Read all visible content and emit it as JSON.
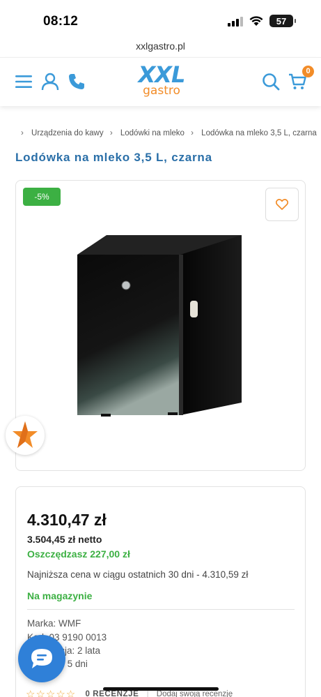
{
  "status": {
    "time": "08:12",
    "battery": "57"
  },
  "browser": {
    "url": "xxlgastro.pl"
  },
  "header": {
    "logo_top": "XXL",
    "logo_bottom": "gastro",
    "cart_count": "0",
    "icons": [
      "menu-icon",
      "user-icon",
      "phone-icon",
      "search-icon",
      "cart-icon"
    ]
  },
  "breadcrumb": [
    "Urządzenia do kawy",
    "Lodówki na mleko",
    "Lodówka na mleko 3,5 L, czarna"
  ],
  "product": {
    "title": "Lodówka na mleko 3,5 L, czarna",
    "discount": "-5%",
    "price_gross": "4.310,47 zł",
    "price_net": "3.504,45 zł netto",
    "savings": "Oszczędzasz 227,00 zł",
    "lowest_price_note": "Najniższa cena w ciągu ostatnich 30 dni - 4.310,59 zł",
    "availability": "Na magazynie",
    "specs": {
      "brand": "Marka: WMF",
      "code": "Kod: 03 9190 0013",
      "warranty": "Gwarancja: 2 lata",
      "shipping": "Wysyłka: 5 dni"
    },
    "reviews": {
      "stars": "☆☆☆☆☆",
      "count_label": "0 RECENZJE",
      "add_label": "Dodaj swoją recenzję"
    }
  },
  "colors": {
    "brand_blue": "#3b9ad9",
    "brand_orange": "#f28c28",
    "green": "#3cb043",
    "title_blue": "#2a6fa8"
  }
}
